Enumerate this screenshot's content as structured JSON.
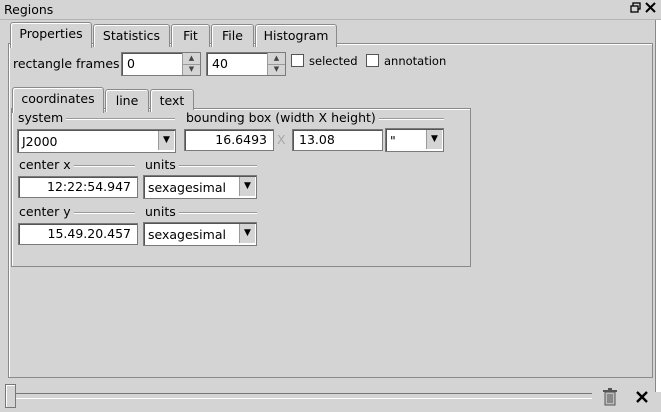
{
  "window": {
    "title": "Regions"
  },
  "main_tabs": [
    {
      "label": "Properties",
      "active": true
    },
    {
      "label": "Statistics",
      "active": false
    },
    {
      "label": "Fit",
      "active": false
    },
    {
      "label": "File",
      "active": false
    },
    {
      "label": "Histogram",
      "active": false
    }
  ],
  "frames": {
    "label": "rectangle frames",
    "first_value": "0",
    "second_value": "40",
    "selected_label": "selected",
    "selected_checked": false,
    "annotation_label": "annotation",
    "annotation_checked": false
  },
  "sub_tabs": [
    {
      "label": "coordinates",
      "active": true
    },
    {
      "label": "line",
      "active": false
    },
    {
      "label": "text",
      "active": false
    }
  ],
  "coords": {
    "system_label": "system",
    "system_value": "J2000",
    "bbox_label": "bounding box (width X height)",
    "width_value": "16.6493",
    "x_separator": "X",
    "height_value": "13.08",
    "bbox_units_value": "\"",
    "center_x_label": "center x",
    "center_x_value": "12:22:54.947",
    "center_x_units_label": "units",
    "center_x_units_value": "sexagesimal",
    "center_y_label": "center y",
    "center_y_value": "15.49.20.457",
    "center_y_units_label": "units",
    "center_y_units_value": "sexagesimal"
  },
  "icons": {
    "restore": "restore-icon",
    "close": "close-icon",
    "trash": "trash-icon"
  }
}
